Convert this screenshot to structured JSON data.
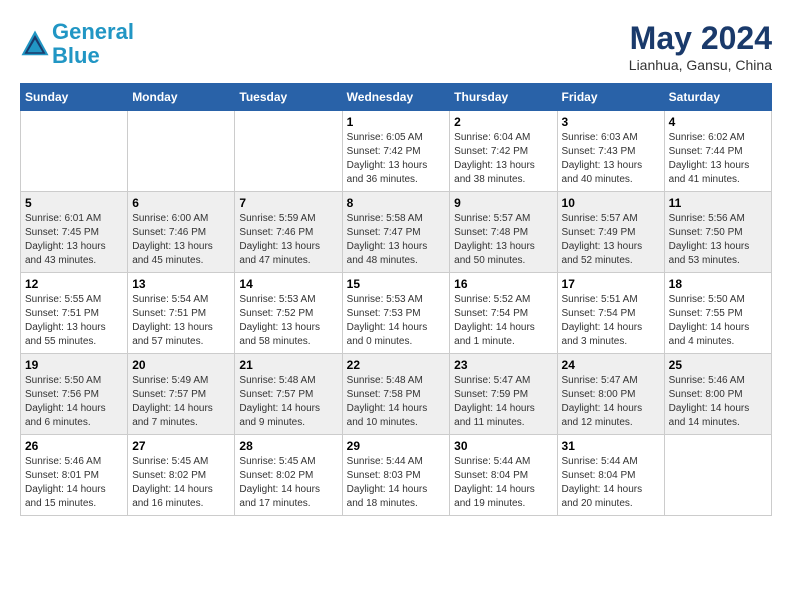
{
  "header": {
    "logo_line1": "General",
    "logo_line2": "Blue",
    "title": "May 2024",
    "subtitle": "Lianhua, Gansu, China"
  },
  "calendar": {
    "days_of_week": [
      "Sunday",
      "Monday",
      "Tuesday",
      "Wednesday",
      "Thursday",
      "Friday",
      "Saturday"
    ],
    "weeks": [
      [
        {
          "day": "",
          "info": ""
        },
        {
          "day": "",
          "info": ""
        },
        {
          "day": "",
          "info": ""
        },
        {
          "day": "1",
          "info": "Sunrise: 6:05 AM\nSunset: 7:42 PM\nDaylight: 13 hours\nand 36 minutes."
        },
        {
          "day": "2",
          "info": "Sunrise: 6:04 AM\nSunset: 7:42 PM\nDaylight: 13 hours\nand 38 minutes."
        },
        {
          "day": "3",
          "info": "Sunrise: 6:03 AM\nSunset: 7:43 PM\nDaylight: 13 hours\nand 40 minutes."
        },
        {
          "day": "4",
          "info": "Sunrise: 6:02 AM\nSunset: 7:44 PM\nDaylight: 13 hours\nand 41 minutes."
        }
      ],
      [
        {
          "day": "5",
          "info": "Sunrise: 6:01 AM\nSunset: 7:45 PM\nDaylight: 13 hours\nand 43 minutes."
        },
        {
          "day": "6",
          "info": "Sunrise: 6:00 AM\nSunset: 7:46 PM\nDaylight: 13 hours\nand 45 minutes."
        },
        {
          "day": "7",
          "info": "Sunrise: 5:59 AM\nSunset: 7:46 PM\nDaylight: 13 hours\nand 47 minutes."
        },
        {
          "day": "8",
          "info": "Sunrise: 5:58 AM\nSunset: 7:47 PM\nDaylight: 13 hours\nand 48 minutes."
        },
        {
          "day": "9",
          "info": "Sunrise: 5:57 AM\nSunset: 7:48 PM\nDaylight: 13 hours\nand 50 minutes."
        },
        {
          "day": "10",
          "info": "Sunrise: 5:57 AM\nSunset: 7:49 PM\nDaylight: 13 hours\nand 52 minutes."
        },
        {
          "day": "11",
          "info": "Sunrise: 5:56 AM\nSunset: 7:50 PM\nDaylight: 13 hours\nand 53 minutes."
        }
      ],
      [
        {
          "day": "12",
          "info": "Sunrise: 5:55 AM\nSunset: 7:51 PM\nDaylight: 13 hours\nand 55 minutes."
        },
        {
          "day": "13",
          "info": "Sunrise: 5:54 AM\nSunset: 7:51 PM\nDaylight: 13 hours\nand 57 minutes."
        },
        {
          "day": "14",
          "info": "Sunrise: 5:53 AM\nSunset: 7:52 PM\nDaylight: 13 hours\nand 58 minutes."
        },
        {
          "day": "15",
          "info": "Sunrise: 5:53 AM\nSunset: 7:53 PM\nDaylight: 14 hours\nand 0 minutes."
        },
        {
          "day": "16",
          "info": "Sunrise: 5:52 AM\nSunset: 7:54 PM\nDaylight: 14 hours\nand 1 minute."
        },
        {
          "day": "17",
          "info": "Sunrise: 5:51 AM\nSunset: 7:54 PM\nDaylight: 14 hours\nand 3 minutes."
        },
        {
          "day": "18",
          "info": "Sunrise: 5:50 AM\nSunset: 7:55 PM\nDaylight: 14 hours\nand 4 minutes."
        }
      ],
      [
        {
          "day": "19",
          "info": "Sunrise: 5:50 AM\nSunset: 7:56 PM\nDaylight: 14 hours\nand 6 minutes."
        },
        {
          "day": "20",
          "info": "Sunrise: 5:49 AM\nSunset: 7:57 PM\nDaylight: 14 hours\nand 7 minutes."
        },
        {
          "day": "21",
          "info": "Sunrise: 5:48 AM\nSunset: 7:57 PM\nDaylight: 14 hours\nand 9 minutes."
        },
        {
          "day": "22",
          "info": "Sunrise: 5:48 AM\nSunset: 7:58 PM\nDaylight: 14 hours\nand 10 minutes."
        },
        {
          "day": "23",
          "info": "Sunrise: 5:47 AM\nSunset: 7:59 PM\nDaylight: 14 hours\nand 11 minutes."
        },
        {
          "day": "24",
          "info": "Sunrise: 5:47 AM\nSunset: 8:00 PM\nDaylight: 14 hours\nand 12 minutes."
        },
        {
          "day": "25",
          "info": "Sunrise: 5:46 AM\nSunset: 8:00 PM\nDaylight: 14 hours\nand 14 minutes."
        }
      ],
      [
        {
          "day": "26",
          "info": "Sunrise: 5:46 AM\nSunset: 8:01 PM\nDaylight: 14 hours\nand 15 minutes."
        },
        {
          "day": "27",
          "info": "Sunrise: 5:45 AM\nSunset: 8:02 PM\nDaylight: 14 hours\nand 16 minutes."
        },
        {
          "day": "28",
          "info": "Sunrise: 5:45 AM\nSunset: 8:02 PM\nDaylight: 14 hours\nand 17 minutes."
        },
        {
          "day": "29",
          "info": "Sunrise: 5:44 AM\nSunset: 8:03 PM\nDaylight: 14 hours\nand 18 minutes."
        },
        {
          "day": "30",
          "info": "Sunrise: 5:44 AM\nSunset: 8:04 PM\nDaylight: 14 hours\nand 19 minutes."
        },
        {
          "day": "31",
          "info": "Sunrise: 5:44 AM\nSunset: 8:04 PM\nDaylight: 14 hours\nand 20 minutes."
        },
        {
          "day": "",
          "info": ""
        }
      ]
    ]
  }
}
